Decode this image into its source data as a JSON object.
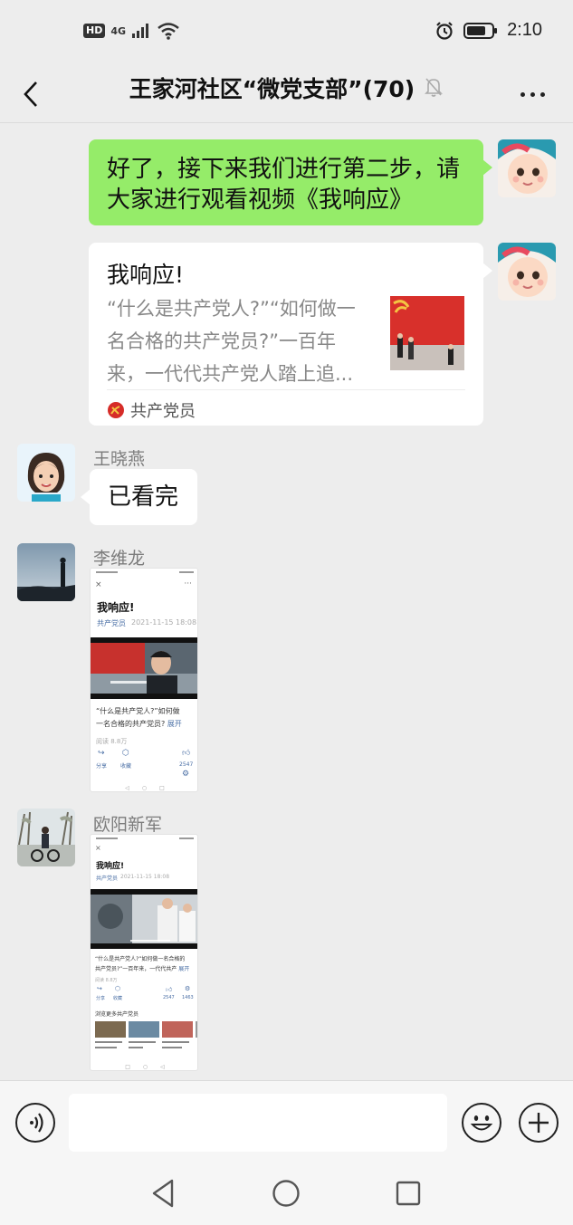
{
  "status_bar": {
    "hd_badge": "HD",
    "network": "4G",
    "time": "2:10"
  },
  "header": {
    "title": "王家河社区“微党支部”(70)",
    "muted_icon": "bell-off-icon",
    "back_icon": "chevron-left-icon",
    "more_icon": "more-dots-icon"
  },
  "messages": [
    {
      "type": "text",
      "side": "right",
      "text_line1": "好了，接下来我们进行第二步，请",
      "text_line2": "大家进行观看视频《我响应》"
    },
    {
      "type": "link_card",
      "side": "right",
      "title": "我响应!",
      "description": "“什么是共产党人?”“如何做一名合格的共产党员?”一百年来，一代代共产党人踏上追...",
      "desc_line1": "“什么是共产党人?”“如何做一",
      "desc_line2": "名合格的共产党员?”一百年",
      "desc_line3": "来，一代代共产党人踏上追...",
      "source": "共产党员",
      "source_icon": "party-emblem-icon"
    },
    {
      "type": "text",
      "side": "left",
      "sender": "王晓燕",
      "text": "已看完"
    },
    {
      "type": "screenshot",
      "side": "left",
      "sender": "李维龙",
      "preview": {
        "title": "我响应!",
        "source": "共产党员",
        "date": "2021-11-15 18:08",
        "caption_line1": "“什么是共产党人?”如何做",
        "caption_line2": "一名合格的共产党员?",
        "expand": "展开",
        "reads": "阅读 8.8万",
        "share": "分享",
        "favorite": "收藏",
        "likes": "2547"
      }
    },
    {
      "type": "screenshot",
      "side": "left",
      "sender": "欧阳新军",
      "preview": {
        "title": "我响应!",
        "source": "共产党员",
        "date": "2021-11-15 18:08",
        "caption_line1": "“什么是共产党人?”如何做一名合格的",
        "caption_line2": "共产党员?”一百年来，一代代共产",
        "expand": "展开",
        "reads": "阅读 8.8万",
        "share": "分享",
        "favorite": "收藏",
        "likes": "2547",
        "count2": "1463",
        "more": "浏览更多共产党员"
      }
    }
  ],
  "input_bar": {
    "placeholder": "",
    "voice_icon": "voice-icon",
    "emoji_icon": "emoji-icon",
    "plus_icon": "plus-icon"
  },
  "colors": {
    "background": "#ededed",
    "bubble_green": "#95ec69",
    "bubble_white": "#ffffff",
    "party_red": "#d62c28"
  }
}
